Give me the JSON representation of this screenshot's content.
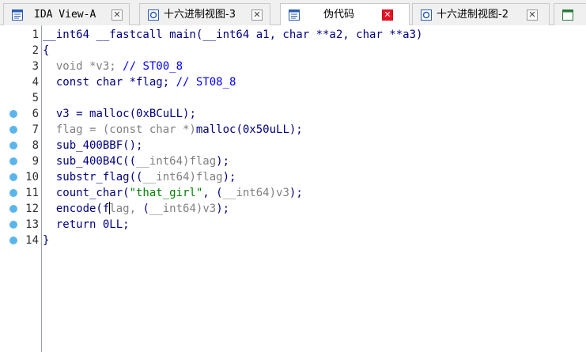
{
  "tabs": [
    {
      "label": "IDA View-A",
      "icon": "ida-view-icon",
      "active": false
    },
    {
      "label": "十六进制视图-3",
      "icon": "hex-view-icon",
      "active": false
    },
    {
      "label": "伪代码",
      "icon": "pseudocode-icon",
      "active": true
    },
    {
      "label": "十六进制视图-2",
      "icon": "hex-view-icon",
      "active": false
    }
  ],
  "colors": {
    "accent": "#5ab6ea",
    "close_active": "#e81123",
    "code_text": "#000080",
    "comment": "#0000ff",
    "string": "#008000",
    "type": "#808080"
  },
  "line_numbers": [
    "1",
    "2",
    "3",
    "4",
    "5",
    "6",
    "7",
    "8",
    "9",
    "10",
    "11",
    "12",
    "13",
    "14"
  ],
  "breakpoint_lines": [
    6,
    7,
    8,
    9,
    10,
    11,
    12,
    13,
    14
  ],
  "code": {
    "l1": "__int64 __fastcall main(__int64 a1, char **a2, char **a3)",
    "l2": "{",
    "l3a": "  void *v3; ",
    "l3b": "// ST00_8",
    "l4a": "  const char *flag; ",
    "l4b": "// ST08_8",
    "l6a": "  v3 = ",
    "l6b": "malloc(0xBCuLL);",
    "l7a": "  flag = (const char *)",
    "l7b": "malloc(0x50uLL);",
    "l8": "  sub_400BBF();",
    "l9a": "  sub_400B4C((",
    "l9b": "__int64)flag",
    "l9c": ");",
    "l10a": "  substr_flag((",
    "l10b": "__int64)flag",
    "l10c": ");",
    "l11a": "  count_char(",
    "l11b": "\"that_girl\"",
    "l11c": ", (",
    "l11d": "__int64)v3",
    "l11e": ");",
    "l12a": "  encode(f",
    "l12b": "lag, ",
    "l12c": "(",
    "l12d": "__int64)v3",
    "l12e": ");",
    "l13": "  return 0LL;",
    "l14": "}"
  }
}
